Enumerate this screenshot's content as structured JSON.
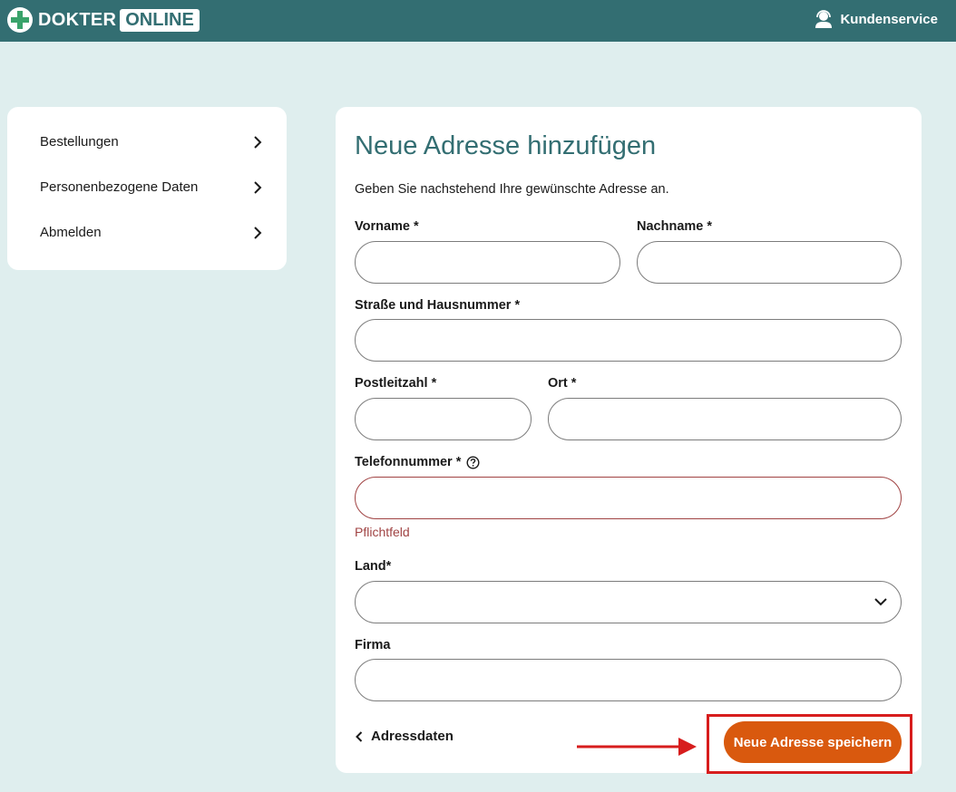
{
  "header": {
    "logo_part1": "DOKTER",
    "logo_part2": "ONLINE",
    "support_label": "Kundenservice"
  },
  "sidebar": {
    "items": [
      {
        "label": "Bestellungen"
      },
      {
        "label": "Personenbezogene Daten"
      },
      {
        "label": "Abmelden"
      }
    ]
  },
  "form": {
    "title": "Neue Adresse hinzufügen",
    "intro": "Geben Sie nachstehend Ihre gewünschte Adresse an.",
    "labels": {
      "first_name": "Vorname  *",
      "last_name": "Nachname  *",
      "street": "Straße und Hausnummer  *",
      "zip": "Postleitzahl  *",
      "city": "Ort  *",
      "phone": "Telefonnummer  *",
      "country": "Land*",
      "company": "Firma"
    },
    "values": {
      "first_name": "",
      "last_name": "",
      "street": "",
      "zip": "",
      "city": "",
      "phone": "",
      "country": "",
      "company": ""
    },
    "phone_error": "Pflichtfeld",
    "back_label": "Adressdaten",
    "save_label": "Neue Adresse speichern"
  },
  "colors": {
    "header_bg": "#336e72",
    "page_bg": "#dfeeee",
    "accent_button": "#d9590e",
    "error": "#a04343",
    "annotation": "#d71d1d"
  }
}
